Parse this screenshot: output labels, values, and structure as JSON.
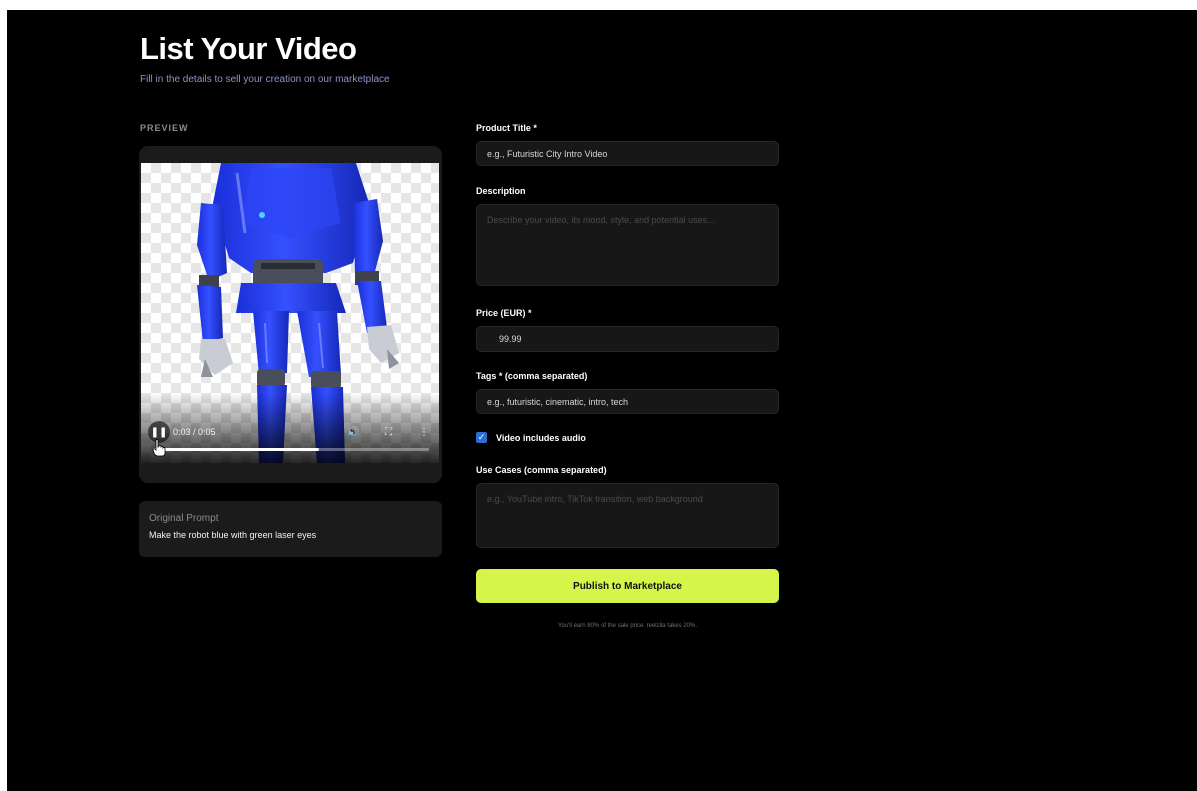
{
  "header": {
    "title": "List Your Video",
    "subtitle": "Fill in the details to sell your creation on our marketplace"
  },
  "preview": {
    "section_label": "PREVIEW",
    "player": {
      "time_display": "0:03 / 0:05",
      "progress": 0.6,
      "state": "playing",
      "icons": {
        "play_pause": "pause-icon",
        "volume": "volume-icon",
        "fullscreen": "fullscreen-icon",
        "more": "more-options-icon"
      }
    },
    "prompt": {
      "label": "Original Prompt",
      "text": "Make the robot blue with green laser eyes"
    }
  },
  "form": {
    "product_title": {
      "label": "Product Title *",
      "placeholder": "e.g., Futuristic City Intro Video",
      "value": ""
    },
    "description": {
      "label": "Description",
      "placeholder": "Describe your video, its mood, style, and potential uses...",
      "value": ""
    },
    "price": {
      "label": "Price (EUR) *",
      "currency_symbol": "€",
      "placeholder": "99.99",
      "value": ""
    },
    "tags": {
      "label": "Tags * (comma separated)",
      "placeholder": "e.g., futuristic, cinematic, intro, tech",
      "value": ""
    },
    "includes_audio": {
      "label": "Video includes audio",
      "checked": true
    },
    "use_cases": {
      "label": "Use Cases (comma separated)",
      "placeholder": "e.g., YouTube intro, TikTok transition, web background",
      "value": ""
    },
    "publish_label": "Publish to Marketplace",
    "earn_note": "You'll earn 80% of the sale price. reelzila takes 20%."
  },
  "colors": {
    "background": "#000000",
    "card": "#1b1b1b",
    "input_bg": "#171717",
    "accent": "#d6f54b",
    "checkbox": "#2f6fd3",
    "subtitle": "#8b93c9"
  }
}
